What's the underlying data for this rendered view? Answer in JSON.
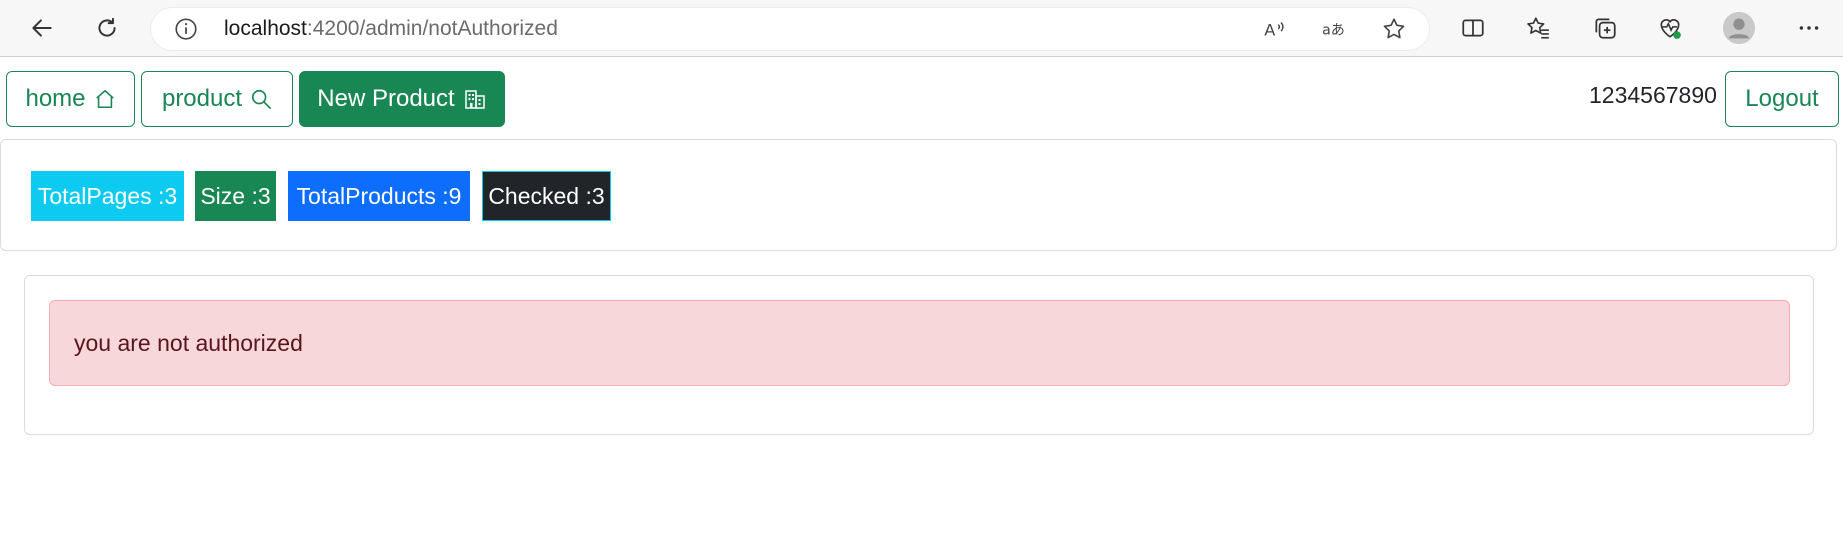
{
  "browser": {
    "url_host": "localhost",
    "url_path": ":4200/admin/notAuthorized",
    "icons": [
      "back-arrow-icon",
      "refresh-icon",
      "site-info-icon",
      "read-aloud-icon",
      "translate-icon",
      "favorite-star-icon",
      "split-screen-icon",
      "favorites-icon",
      "collections-icon",
      "browser-essentials-icon",
      "profile-avatar-icon",
      "more-menu-icon"
    ]
  },
  "nav": {
    "home_label": "home",
    "product_label": "product",
    "new_product_label": "New Product",
    "username": "1234567890",
    "logout_label": "Logout"
  },
  "stats": {
    "total_pages": "TotalPages :3",
    "size": "Size :3",
    "total_products": "TotalProducts :9",
    "checked": "Checked :3"
  },
  "alert": {
    "message": "you are not authorized"
  },
  "colors": {
    "success": "#198754",
    "info": "#0dcaf0",
    "primary": "#0d6efd",
    "dark": "#212529",
    "danger_bg": "#f8d7da"
  }
}
